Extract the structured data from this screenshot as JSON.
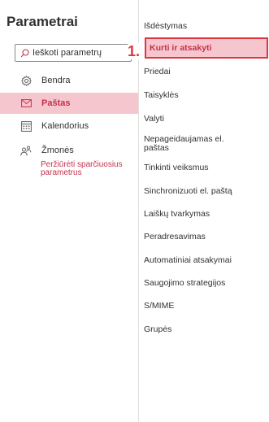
{
  "settings": {
    "title": "Parametrai",
    "search": {
      "placeholder": "Ieškoti parametrų"
    },
    "nav": [
      {
        "label": "Bendra",
        "icon": "gear-icon"
      },
      {
        "label": "Paštas",
        "icon": "mail-icon",
        "active": true
      },
      {
        "label": "Kalendorius",
        "icon": "calendar-icon"
      },
      {
        "label": "Žmonės",
        "icon": "people-icon"
      }
    ],
    "quick_settings_link": "Peržiūrėti sparčiuosius parametrus",
    "accent_color": "#c4314b",
    "active_bg_color": "#f5c6cd"
  },
  "mail_subnav": [
    "Išdėstymas",
    "Kurti ir atsakyti",
    "Priedai",
    "Taisyklės",
    "Valyti",
    "Nepageidaujamas el. paštas",
    "Tinkinti veiksmus",
    "Sinchronizuoti el. paštą",
    "Laiškų tvarkymas",
    "Peradresavimas",
    "Automatiniai atsakymai",
    "Saugojimo strategijos",
    "S/MIME",
    "Grupės"
  ],
  "annotation": {
    "step_label": "1.",
    "color": "#e03540"
  }
}
